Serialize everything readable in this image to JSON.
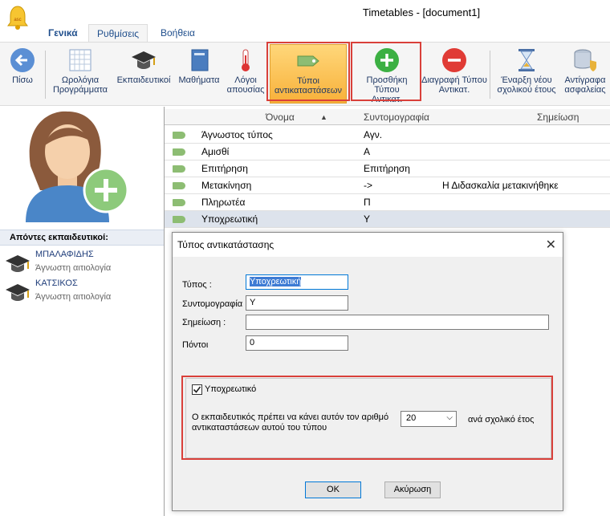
{
  "window": {
    "title": "Timetables - [document1]"
  },
  "menu_tabs": [
    "Γενικά",
    "Ρυθμίσεις",
    "Βοήθεια"
  ],
  "ribbon": {
    "back": "Πίσω",
    "timetables": [
      "Ωρολόγια",
      "Προγράμματα"
    ],
    "teachers": "Εκπαιδευτικοί",
    "lessons": "Μαθήματα",
    "absence_reasons": [
      "Λόγοι",
      "απουσίας"
    ],
    "sub_types": [
      "Τύποι",
      "αντικαταστάσεων"
    ],
    "add_type": [
      "Προσθήκη Τύπου",
      "Αντικατ."
    ],
    "delete_type": [
      "Διαγραφή Τύπου",
      "Αντικατ."
    ],
    "new_year": [
      "Έναρξη νέου",
      "σχολικού έτους"
    ],
    "backup": [
      "Αντίγραφα",
      "ασφαλείας"
    ]
  },
  "left_panel": {
    "header": "Απόντες εκπαιδευτικοί:",
    "teachers": [
      {
        "name": "ΜΠΑΛΑΦΙΔΗΣ",
        "reason": "Άγνωστη αιτιολογία"
      },
      {
        "name": "ΚΑΤΣΙΚΟΣ",
        "reason": "Άγνωστη αιτιολογία"
      }
    ]
  },
  "grid": {
    "columns": [
      "Όνομα",
      "Συντομογραφία",
      "Σημείωση"
    ],
    "rows": [
      {
        "name": "Άγνωστος τύπος",
        "abbr": "Αγν.",
        "note": ""
      },
      {
        "name": "Αμισθί",
        "abbr": "Α",
        "note": ""
      },
      {
        "name": "Επιτήρηση",
        "abbr": "Επιτήρηση",
        "note": ""
      },
      {
        "name": "Μετακίνηση",
        "abbr": "->",
        "note": "Η Διδασκαλία μετακινήθηκε"
      },
      {
        "name": "Πληρωτέα",
        "abbr": "Π",
        "note": ""
      },
      {
        "name": "Υποχρεωτική",
        "abbr": "Υ",
        "note": ""
      }
    ]
  },
  "dialog": {
    "title": "Τύπος αντικατάστασης",
    "type_label": "Τύπος :",
    "type_value": "Υποχρεωτική",
    "abbr_label": "Συντομογραφία",
    "abbr_value": "Υ",
    "note_label": "Σημείωση :",
    "note_value": "",
    "points_label": "Πόντοι",
    "points_value": "0",
    "mandatory_label": "Υποχρεωτικό",
    "mandatory_checked": true,
    "requirement_text_1": "Ο εκπαιδευτικός πρέπει να κάνει αυτόν τον αριθμό",
    "requirement_text_2": "αντικαταστάσεων αυτού του τύπου",
    "count_value": "20",
    "per_year": "ανά σχολικό έτος",
    "ok": "OK",
    "cancel": "Ακύρωση"
  },
  "colors": {
    "accent": "#1f4e8c",
    "highlight_box": "#d9403a",
    "selected_button": "#f8b13a",
    "tag_green": "#8dbd73"
  }
}
